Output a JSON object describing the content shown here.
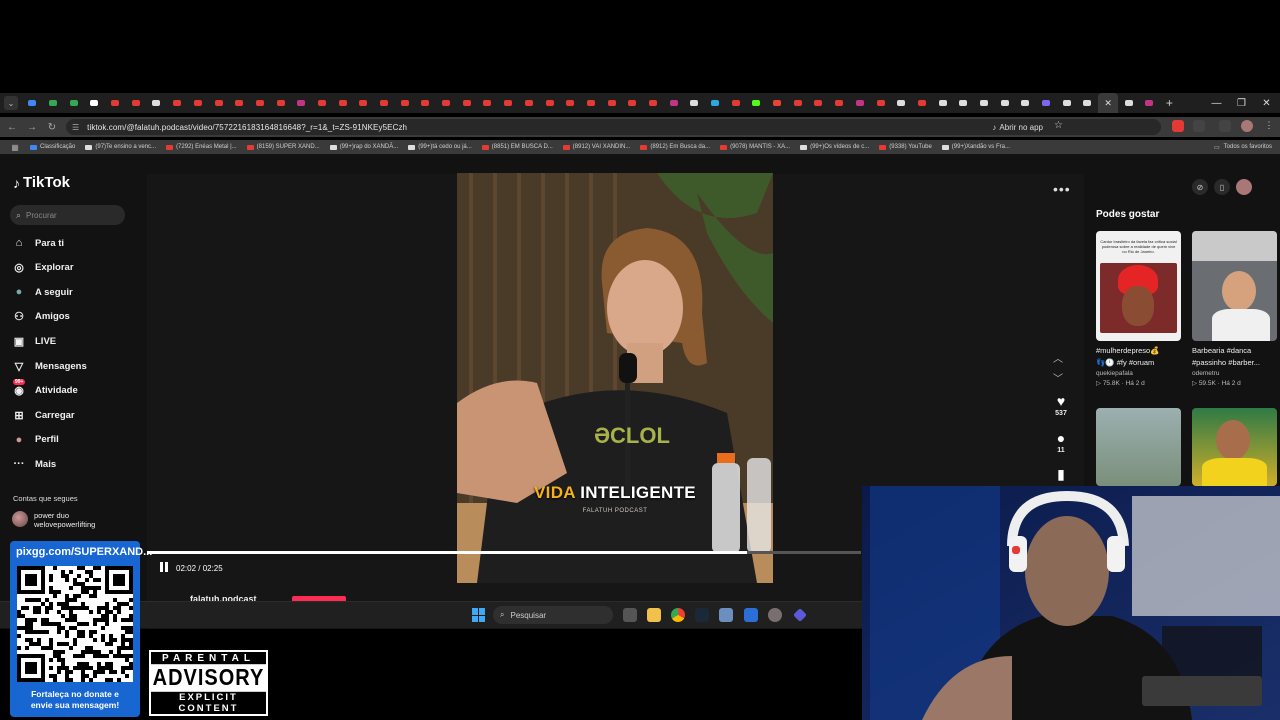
{
  "browser": {
    "url": "tiktok.com/@falatuh.podcast/video/7572216183164816648?_r=1&_t=ZS-91NKEy5ECzh",
    "open_in_app": "Abrir no app",
    "bookmarks": [
      "Classificação",
      "(97)Te ensino a venc...",
      "(7292) Enéas Metal |...",
      "(8159) SUPER XAND...",
      "(99+)rap do XANDÃ...",
      "(99+)tá cedo ou já...",
      "(8851) EM BUSCA D...",
      "(8912) VAI XANDIN...",
      "(8912) Em Busca da...",
      "(9078) MANTIS - XA...",
      "(99+)Os vídeos de c...",
      "(9338) YouTube",
      "(99+)Xandão vs Fra..."
    ],
    "all_bookmarks": "Todos os favoritos"
  },
  "tiktok": {
    "logo": "TikTok",
    "search_placeholder": "Procurar",
    "nav": [
      {
        "label": "Para ti",
        "icon": "home-icon"
      },
      {
        "label": "Explorar",
        "icon": "compass-icon"
      },
      {
        "label": "A seguir",
        "icon": "following-avatar-icon"
      },
      {
        "label": "Amigos",
        "icon": "friends-icon"
      },
      {
        "label": "LIVE",
        "icon": "live-icon"
      },
      {
        "label": "Mensagens",
        "icon": "messages-icon"
      },
      {
        "label": "Atividade",
        "icon": "activity-icon"
      },
      {
        "label": "Carregar",
        "icon": "upload-icon"
      },
      {
        "label": "Perfil",
        "icon": "profile-avatar-icon"
      },
      {
        "label": "Mais",
        "icon": "more-dots-icon"
      }
    ],
    "activity_badge": "99+",
    "following_heading": "Contas que segues",
    "following_accounts": [
      {
        "line1": "power duo",
        "line2": "welovepowerlifting"
      }
    ],
    "video": {
      "caption_highlight": "VIDA",
      "caption_rest": "INTELIGENTE",
      "caption_sub": "FALATUH PODCAST",
      "time": "02:02 / 02:25",
      "progress": 0.841,
      "author": "falatuh.podcast"
    },
    "actions": {
      "likes": "537",
      "comments": "11"
    },
    "suggestions_title": "Podes gostar",
    "suggestions": [
      {
        "title1": "#mulherdepreso💰",
        "title2": "👣🕛 #fy #oruam",
        "user": "quekiepafala",
        "views": "75.8K",
        "age": "Há 2 d"
      },
      {
        "title1": "Barbearia #danca",
        "title2": "#passinho #barber...",
        "user": "odemetru",
        "views": "59.5K",
        "age": "Há 2 d"
      }
    ],
    "thumb_text": "Cantor brasileiro da favela faz crítica social poderosa sobre a realidade de quem vive no Rio de Janeiro."
  },
  "taskbar": {
    "search_placeholder": "Pesquisar"
  },
  "overlay": {
    "donate_url": "pixgg.com/SUPERXAND...",
    "donate_line1": "Fortaleça no donate e",
    "donate_line2": "envie sua mensagem!",
    "advisory_top": "PARENTAL",
    "advisory_mid": "ADVISORY",
    "advisory_bottom": "EXPLICIT CONTENT"
  },
  "colors": {
    "tiktok_red": "#fe2c55",
    "caption_yellow": "#f5b21b",
    "donate_blue": "#1766d1"
  }
}
